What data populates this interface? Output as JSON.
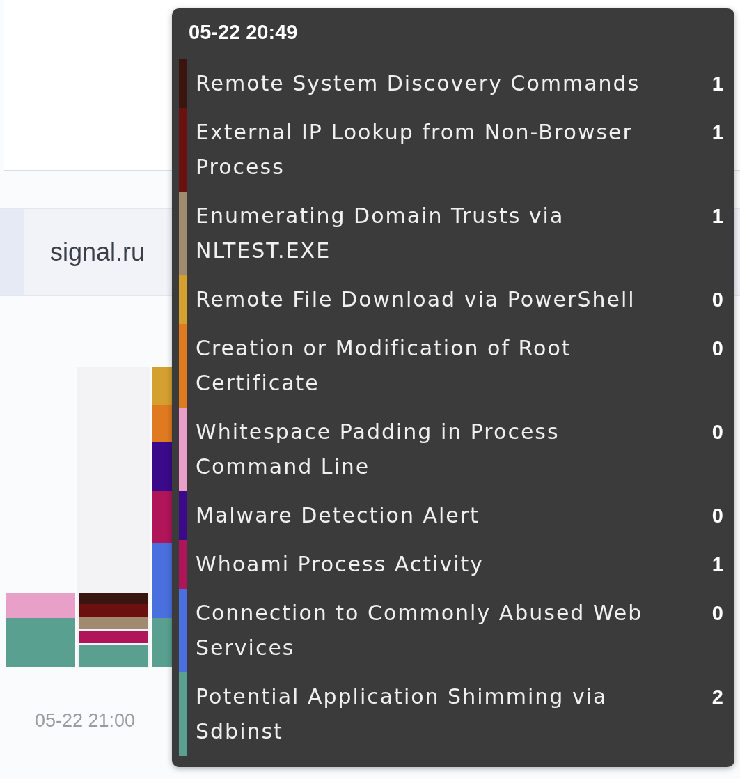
{
  "page": {
    "domain_label": "signal.ru",
    "chart": {
      "x_label": "05-22 21:00"
    }
  },
  "tooltip": {
    "title": "05-22 20:49",
    "items": [
      {
        "name": "Remote System Discovery Commands",
        "count": "1",
        "color": "#3a1510"
      },
      {
        "name": "External IP Lookup from Non-Browser Process",
        "count": "1",
        "color": "#6b0f0f"
      },
      {
        "name": "Enumerating Domain Trusts via NLTEST.EXE",
        "count": "1",
        "color": "#a08a70"
      },
      {
        "name": "Remote File Download via PowerShell",
        "count": "0",
        "color": "#d4a030"
      },
      {
        "name": "Creation or Modification of Root Certificate",
        "count": "0",
        "color": "#e07a20"
      },
      {
        "name": "Whitespace Padding in Process Command Line",
        "count": "0",
        "color": "#e8a0c8"
      },
      {
        "name": "Malware Detection Alert",
        "count": "0",
        "color": "#3a0a8a"
      },
      {
        "name": "Whoami Process Activity",
        "count": "1",
        "color": "#b0155a"
      },
      {
        "name": "Connection to Commonly Abused Web Services",
        "count": "0",
        "color": "#4a70e0"
      },
      {
        "name": "Potential Application Shimming via Sdbinst",
        "count": "2",
        "color": "#5aa090"
      }
    ]
  }
}
